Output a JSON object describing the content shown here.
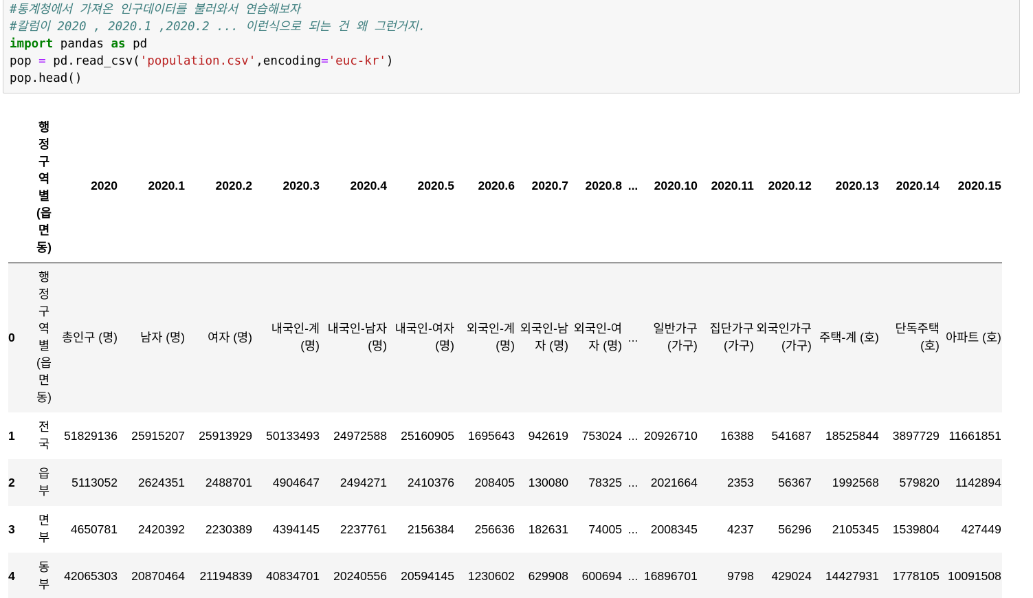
{
  "code_cell": {
    "comment1": "#통계청에서 가져온 인구데이터를 불러와서 연습해보자",
    "comment2": "#칼럼이 2020 , 2020.1 ,2020.2 ... 이런식으로 되는 건 왜 그런거지.",
    "line3": {
      "kw_import": "import",
      "mid": " pandas ",
      "kw_as": "as",
      "tail": " pd"
    },
    "line4": {
      "a": "pop ",
      "eq": "=",
      "b": " pd.read_csv(",
      "str1": "'population.csv'",
      "c": ",encoding",
      "eq2": "=",
      "str2": "'euc-kr'",
      "d": ")"
    },
    "line5": "pop.head()"
  },
  "table": {
    "index_header": "행정구역별(읍면동)",
    "columns": [
      "2020",
      "2020.1",
      "2020.2",
      "2020.3",
      "2020.4",
      "2020.5",
      "2020.6",
      "2020.7",
      "2020.8",
      "...",
      "2020.10",
      "2020.11",
      "2020.12",
      "2020.13",
      "2020.14",
      "2020.15"
    ],
    "rows": [
      {
        "index": "0",
        "region": "행정구역별(읍면동)",
        "values": [
          "총인구 (명)",
          "남자 (명)",
          "여자 (명)",
          "내국인-계 (명)",
          "내국인-남자 (명)",
          "내국인-여자 (명)",
          "외국인-계 (명)",
          "외국인-남자 (명)",
          "외국인-여자 (명)",
          "...",
          "일반가구 (가구)",
          "집단가구 (가구)",
          "외국인가구 (가구)",
          "주택-계 (호)",
          "단독주택 (호)",
          "아파트 (호)"
        ]
      },
      {
        "index": "1",
        "region": "전국",
        "values": [
          "51829136",
          "25915207",
          "25913929",
          "50133493",
          "24972588",
          "25160905",
          "1695643",
          "942619",
          "753024",
          "...",
          "20926710",
          "16388",
          "541687",
          "18525844",
          "3897729",
          "11661851"
        ]
      },
      {
        "index": "2",
        "region": "읍부",
        "values": [
          "5113052",
          "2624351",
          "2488701",
          "4904647",
          "2494271",
          "2410376",
          "208405",
          "130080",
          "78325",
          "...",
          "2021664",
          "2353",
          "56367",
          "1992568",
          "579820",
          "1142894"
        ]
      },
      {
        "index": "3",
        "region": "면부",
        "values": [
          "4650781",
          "2420392",
          "2230389",
          "4394145",
          "2237761",
          "2156384",
          "256636",
          "182631",
          "74005",
          "...",
          "2008345",
          "4237",
          "56296",
          "2105345",
          "1539804",
          "427449"
        ]
      },
      {
        "index": "4",
        "region": "동부",
        "values": [
          "42065303",
          "20870464",
          "21194839",
          "40834701",
          "20240556",
          "20594145",
          "1230602",
          "629908",
          "600694",
          "...",
          "16896701",
          "9798",
          "429024",
          "14427931",
          "1778105",
          "10091508"
        ]
      }
    ]
  }
}
